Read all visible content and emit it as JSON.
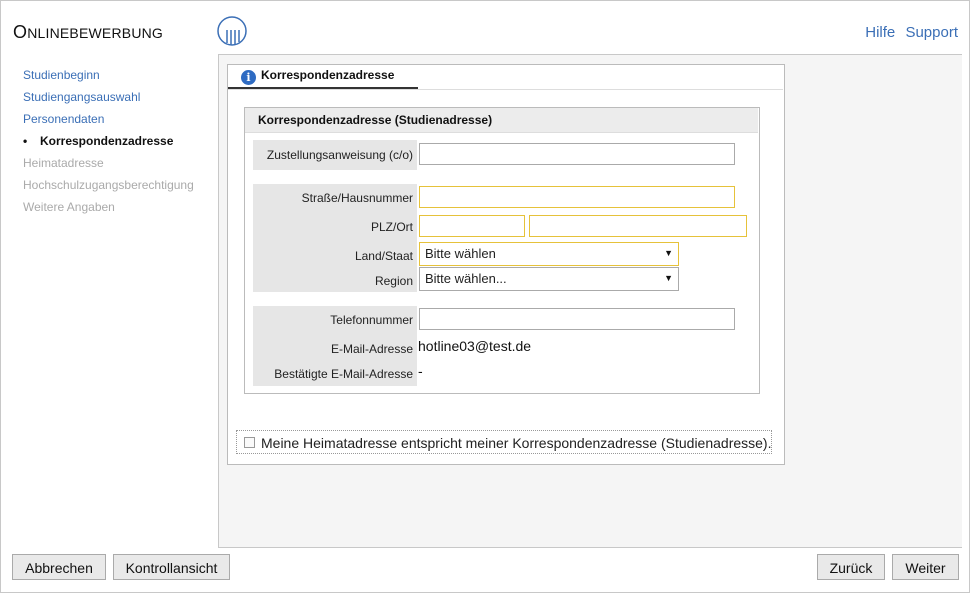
{
  "header": {
    "title_first": "O",
    "title_rest": "NLINEBEWERBUNG",
    "links": [
      "Hilfe",
      "Support"
    ]
  },
  "sidenav": {
    "items": [
      {
        "label": "Studienbeginn",
        "state": "done"
      },
      {
        "label": "Studiengangsauswahl",
        "state": "done"
      },
      {
        "label": "Personendaten",
        "state": "done"
      },
      {
        "label": "Korrespondenzadresse",
        "state": "active"
      },
      {
        "label": "Heimatadresse",
        "state": "todo"
      },
      {
        "label": "Hochschulzugangsberechtigung",
        "state": "todo"
      },
      {
        "label": "Weitere Angaben",
        "state": "todo"
      }
    ],
    "bullet": "•"
  },
  "tab": {
    "label": "Korrespondenzadresse",
    "icon": "info-icon",
    "icon_glyph": "i"
  },
  "fieldset": {
    "title": "Korrespondenzadresse (Studienadresse)",
    "labels": {
      "co": "Zustellungsanweisung (c/o)",
      "street": "Straße/Hausnummer",
      "plz": "PLZ/Ort",
      "country": "Land/Staat",
      "region": "Region",
      "phone": "Telefonnummer",
      "email": "E-Mail-Adresse",
      "email_confirmed": "Bestätigte E-Mail-Adresse"
    },
    "values": {
      "co": "",
      "street": "",
      "plz": "",
      "ort": "",
      "country": "Bitte wählen",
      "region": "Bitte wählen...",
      "phone": "",
      "email": "hotline03@test.de",
      "email_confirmed": "-"
    }
  },
  "checkbox": {
    "label": "Meine Heimatadresse entspricht meiner Korrespondenzadresse (Studienadresse).",
    "checked": false
  },
  "buttons": {
    "cancel": "Abbrechen",
    "review": "Kontrollansicht",
    "back": "Zurück",
    "next": "Weiter"
  },
  "colors": {
    "link": "#3b6fb6",
    "required_border": "#e6c23a",
    "info": "#2e6bc2"
  }
}
